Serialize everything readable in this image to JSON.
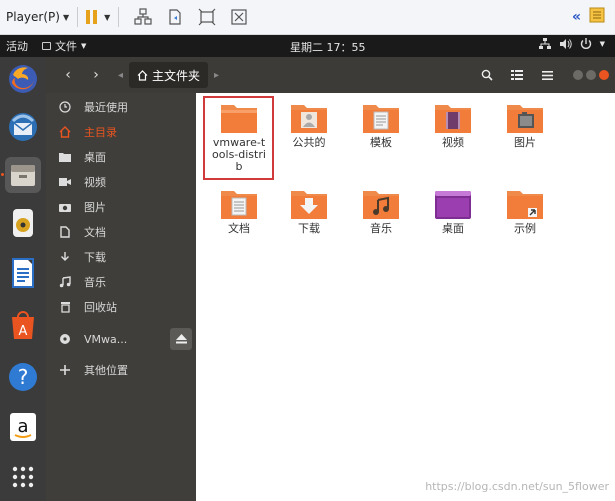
{
  "vm_toolbar": {
    "player_label": "Player(P)",
    "icons": [
      "pause-icon",
      "send-ctrl-alt-del-icon",
      "removable-devices-icon",
      "fullscreen-icon",
      "unity-icon",
      "collapse-toolbar-icon",
      "library-icon"
    ]
  },
  "topbar": {
    "activities": "活动",
    "app_menu": "文件",
    "clock": "星期二 17：55",
    "status_icons": [
      "network-icon",
      "volume-icon",
      "power-icon"
    ]
  },
  "dock": {
    "items": [
      "firefox",
      "thunderbird",
      "files",
      "rhythmbox",
      "libreoffice-writer",
      "ubuntu-software",
      "help",
      "amazon",
      "show-applications"
    ]
  },
  "header": {
    "location": "主文件夹"
  },
  "sidebar": {
    "items": [
      {
        "label": "最近使用",
        "icon": "clock-icon"
      },
      {
        "label": "主目录",
        "icon": "home-icon",
        "selected": true
      },
      {
        "label": "桌面",
        "icon": "desktop-folder-icon"
      },
      {
        "label": "视频",
        "icon": "video-icon"
      },
      {
        "label": "图片",
        "icon": "camera-icon"
      },
      {
        "label": "文档",
        "icon": "document-icon"
      },
      {
        "label": "下载",
        "icon": "download-icon"
      },
      {
        "label": "音乐",
        "icon": "music-icon"
      },
      {
        "label": "回收站",
        "icon": "trash-icon"
      },
      {
        "label": "VMwa...",
        "icon": "disc-icon"
      },
      {
        "label": "其他位置",
        "icon": "plus-icon"
      }
    ]
  },
  "files": [
    {
      "label": "vmware-tools-distrib",
      "icon": "folder-plain"
    },
    {
      "label": "公共的",
      "icon": "folder-public"
    },
    {
      "label": "模板",
      "icon": "folder-templates"
    },
    {
      "label": "视频",
      "icon": "folder-videos"
    },
    {
      "label": "图片",
      "icon": "folder-pictures"
    },
    {
      "label": "文档",
      "icon": "folder-documents"
    },
    {
      "label": "下载",
      "icon": "folder-downloads"
    },
    {
      "label": "音乐",
      "icon": "folder-music"
    },
    {
      "label": "桌面",
      "icon": "folder-desktop"
    },
    {
      "label": "示例",
      "icon": "folder-examples"
    }
  ],
  "watermark": "https://blog.csdn.net/sun_5flower",
  "colors": {
    "accent": "#e95420",
    "highlight": "#d03a3a",
    "folder": "#ef8a4a"
  }
}
